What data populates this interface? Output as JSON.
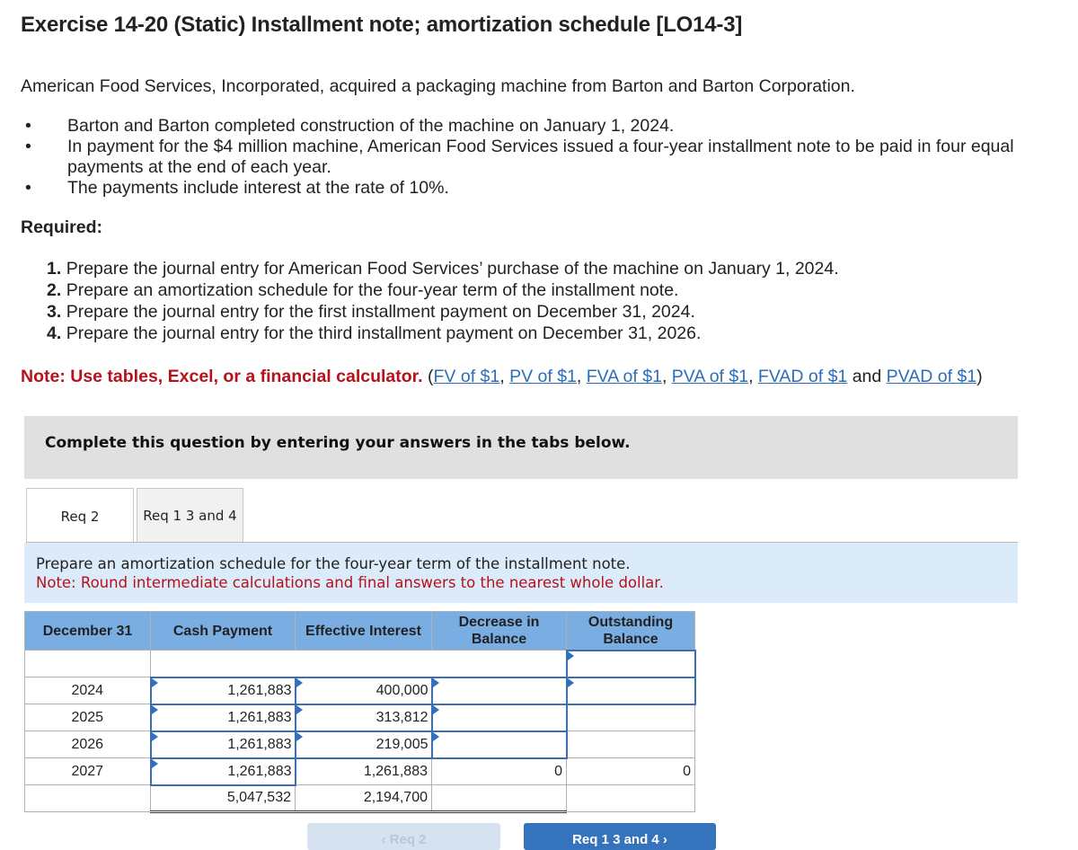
{
  "title": "Exercise 14-20 (Static) Installment note; amortization schedule [LO14-3]",
  "intro": "American Food Services, Incorporated, acquired a packaging machine from Barton and Barton Corporation.",
  "bullets": [
    "Barton and Barton completed construction of the machine on January 1, 2024.",
    "In payment for the $4 million machine, American Food Services issued a four-year installment note to be paid in four equal payments at the end of each year.",
    "The payments include interest at the rate of 10%."
  ],
  "required_label": "Required:",
  "requirements": [
    {
      "num": "1.",
      "text": "Prepare the journal entry for American Food Services’ purchase of the machine on January 1, 2024."
    },
    {
      "num": "2.",
      "text": "Prepare an amortization schedule for the four-year term of the installment note."
    },
    {
      "num": "3.",
      "text": "Prepare the journal entry for the first installment payment on December 31, 2024."
    },
    {
      "num": "4.",
      "text": "Prepare the journal entry for the third installment payment on December 31, 2026."
    }
  ],
  "note": {
    "bold": "Note: Use tables, Excel, or a financial calculator.",
    "open": " (",
    "links": [
      "FV of $1",
      "PV of $1",
      "FVA of $1",
      "PVA of $1",
      "FVAD of $1",
      "PVAD of $1"
    ],
    "sep": ", ",
    "and": " and ",
    "close": ")"
  },
  "complete_prompt": "Complete this question by entering your answers in the tabs below.",
  "tabs": [
    {
      "label": "Req 2",
      "active": true
    },
    {
      "label": "Req 1 3 and 4",
      "active": false
    }
  ],
  "instructions": {
    "line1": "Prepare an amortization schedule for the four-year term of the installment note.",
    "line2": "Note: Round intermediate calculations and final answers to the nearest whole dollar."
  },
  "table": {
    "headers": [
      "December 31",
      "Cash Payment",
      "Effective Interest",
      "Decrease in Balance",
      "Outstanding Balance"
    ],
    "header_lines": [
      [
        "December 31"
      ],
      [
        "Cash Payment"
      ],
      [
        "Effective Interest"
      ],
      [
        "Decrease in",
        "Balance"
      ],
      [
        "Outstanding",
        "Balance"
      ]
    ],
    "initial_row": {
      "outstanding_balance": ""
    },
    "rows": [
      {
        "year": "2024",
        "cash_payment": "1,261,883",
        "effective_interest": "400,000",
        "decrease_in_balance": "",
        "outstanding_balance": ""
      },
      {
        "year": "2025",
        "cash_payment": "1,261,883",
        "effective_interest": "313,812",
        "decrease_in_balance": "",
        "outstanding_balance": ""
      },
      {
        "year": "2026",
        "cash_payment": "1,261,883",
        "effective_interest": "219,005",
        "decrease_in_balance": "",
        "outstanding_balance": ""
      },
      {
        "year": "2027",
        "cash_payment": "1,261,883",
        "effective_interest": "1,261,883",
        "decrease_in_balance": "0",
        "outstanding_balance": "0"
      }
    ],
    "totals": {
      "cash_payment": "5,047,532",
      "effective_interest": "2,194,700"
    }
  },
  "nav": {
    "prev_label": "‹  Req 2",
    "next_label": "Req 1 3 and 4  ›"
  }
}
